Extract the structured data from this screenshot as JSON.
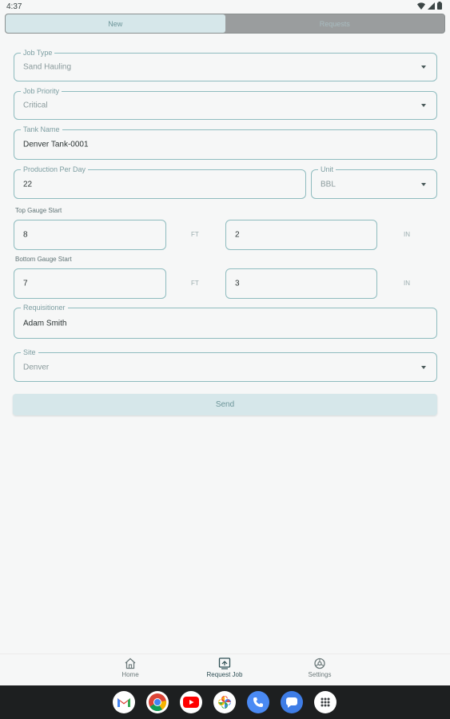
{
  "status_bar": {
    "time": "4:37"
  },
  "tabs": [
    {
      "label": "New",
      "active": true
    },
    {
      "label": "Requests",
      "active": false
    }
  ],
  "form": {
    "job_type": {
      "label": "Job Type",
      "value": "Sand Hauling"
    },
    "job_priority": {
      "label": "Job Priority",
      "value": "Critical"
    },
    "tank_name": {
      "label": "Tank Name",
      "value": "Denver Tank-0001"
    },
    "production_per_day": {
      "label": "Production Per Day",
      "value": "22"
    },
    "unit": {
      "label": "Unit",
      "value": "BBL"
    },
    "top_gauge": {
      "label": "Top Gauge Start",
      "ft": "8",
      "in": "2",
      "ft_unit": "FT",
      "in_unit": "IN"
    },
    "bottom_gauge": {
      "label": "Bottom Gauge Start",
      "ft": "7",
      "in": "3",
      "ft_unit": "FT",
      "in_unit": "IN"
    },
    "requisitioner": {
      "label": "Requisitioner",
      "value": "Adam Smith"
    },
    "site": {
      "label": "Site",
      "value": "Denver"
    },
    "send_label": "Send"
  },
  "bottom_nav": [
    {
      "label": "Home",
      "icon": "home-icon"
    },
    {
      "label": "Request Job",
      "icon": "request-job-icon",
      "active": true
    },
    {
      "label": "Settings",
      "icon": "settings-icon"
    }
  ],
  "dock": [
    "gmail-icon",
    "chrome-icon",
    "youtube-icon",
    "photos-icon",
    "phone-icon",
    "messages-icon",
    "app-drawer-icon"
  ],
  "colors": {
    "accent": "#d6e7ea",
    "field_border": "#8fbcbf",
    "label": "#7d9ea2"
  }
}
